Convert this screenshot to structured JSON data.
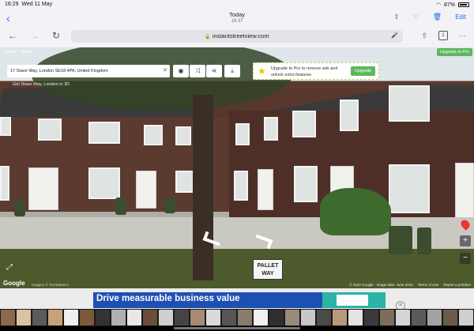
{
  "status_bar": {
    "time": "16:29",
    "date": "Wed 11 May",
    "battery": "87%"
  },
  "header": {
    "title": "Today",
    "subtitle": "16:37",
    "edit_label": "Edit"
  },
  "browser": {
    "url": "instantstreetview.com",
    "tab_count": "2"
  },
  "streetview": {
    "home_link": "Home",
    "about_link": "About",
    "upgrade_top": "Upgrade to Pro",
    "address": "17 Stave Way, London SE18 4PA, United Kingdom",
    "promo_text": "Upgrade to Pro to remove ads and unlock extra features",
    "promo_button": "Upgrade",
    "minilink": "Get Stave Way, London in 3D",
    "street_sign": [
      "PALLET",
      "WAY"
    ],
    "google": "Google",
    "fineprint": "Imagery © TerraMetrics",
    "copyright": "© 2022 Google · Image date: June 2016",
    "terms": "Terms of Use",
    "report": "Report a problem"
  },
  "ad": {
    "headline": "Drive measurable business value"
  },
  "colors": {
    "accent": "#1a73e8",
    "ad_blue": "#1e50b4",
    "upgrade_green": "#5cb85c"
  },
  "thumb_colors": [
    "#8a6a4a",
    "#d9c3a3",
    "#5b5b5b",
    "#c9a27a",
    "#efefef",
    "#7a5a3a",
    "#333",
    "#b0b0b0",
    "#e8e8e8",
    "#6a4d3a",
    "#cfcfcf",
    "#444",
    "#a58b6f",
    "#dadada",
    "#555",
    "#8c7b6a",
    "#f0f0f0",
    "#2f2f2f",
    "#9a8a7a",
    "#c7c7c7",
    "#4a4a4a",
    "#b89a7a",
    "#e3e3e3",
    "#3a3a3a",
    "#7d6d5d",
    "#d5d5d5",
    "#5a5a5a",
    "#a3a3a3",
    "#6b5b4b",
    "#cfcfcf"
  ]
}
